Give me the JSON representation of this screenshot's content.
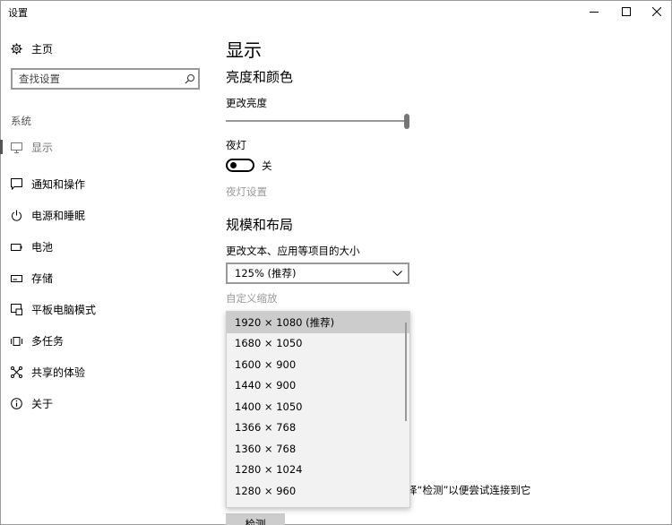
{
  "window": {
    "title": "设置",
    "minimize_label": "最小化",
    "maximize_label": "最大化",
    "close_label": "关闭"
  },
  "sidebar": {
    "home": {
      "label": "主页",
      "icon": "gear-icon"
    },
    "search": {
      "placeholder": "查找设置",
      "icon": "search-icon"
    },
    "section": "系统",
    "items": [
      {
        "label": "显示",
        "icon": "monitor-icon",
        "active": true
      },
      {
        "label": "通知和操作",
        "icon": "message-icon"
      },
      {
        "label": "电源和睡眠",
        "icon": "power-icon"
      },
      {
        "label": "电池",
        "icon": "battery-icon"
      },
      {
        "label": "存储",
        "icon": "storage-icon"
      },
      {
        "label": "平板电脑模式",
        "icon": "tablet-icon"
      },
      {
        "label": "多任务",
        "icon": "multitask-icon"
      },
      {
        "label": "共享的体验",
        "icon": "share-icon"
      },
      {
        "label": "关于",
        "icon": "info-icon"
      }
    ]
  },
  "main": {
    "title": "显示",
    "brightness": {
      "heading": "亮度和颜色",
      "label": "更改亮度",
      "value_fraction": 1.0
    },
    "night_light": {
      "label": "夜灯",
      "state": "关",
      "settings_link": "夜灯设置"
    },
    "scale_layout": {
      "heading": "规模和布局",
      "size_label": "更改文本、应用等项目的大小",
      "size_value": "125% (推荐)",
      "custom_scaling": "自定义缩放"
    },
    "resolution_options": [
      "1920 × 1080 (推荐)",
      "1680 × 1050",
      "1600 × 900",
      "1440 × 900",
      "1400 × 1050",
      "1366 × 768",
      "1360 × 768",
      "1280 × 1024",
      "1280 × 960"
    ],
    "resolution_selected_index": 0,
    "partial_text": "择“检测”以便尝试连接到它",
    "detect_button": "检测"
  },
  "colors": {
    "background": "#ffffff",
    "dropdown_bg": "#f2f2f2",
    "selected_option": "#cccccc",
    "disabled_text": "#999999"
  }
}
